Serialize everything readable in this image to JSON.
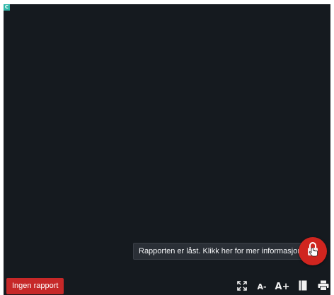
{
  "viewer": {
    "corner_badge": "C"
  },
  "lock": {
    "tooltip": "Rapporten er låst. Klikk her for mer informasjon",
    "icon": "lock-hand-icon",
    "accent": "#d0251f"
  },
  "bottom_bar": {
    "no_report_label": "Ingen rapport",
    "font_decrease_label": "A-",
    "font_increase_label": "A+",
    "icons": [
      "fullscreen-icon",
      "document-icon",
      "print-icon"
    ]
  },
  "colors": {
    "viewer_bg": "#151a1f",
    "danger": "#c62828"
  }
}
